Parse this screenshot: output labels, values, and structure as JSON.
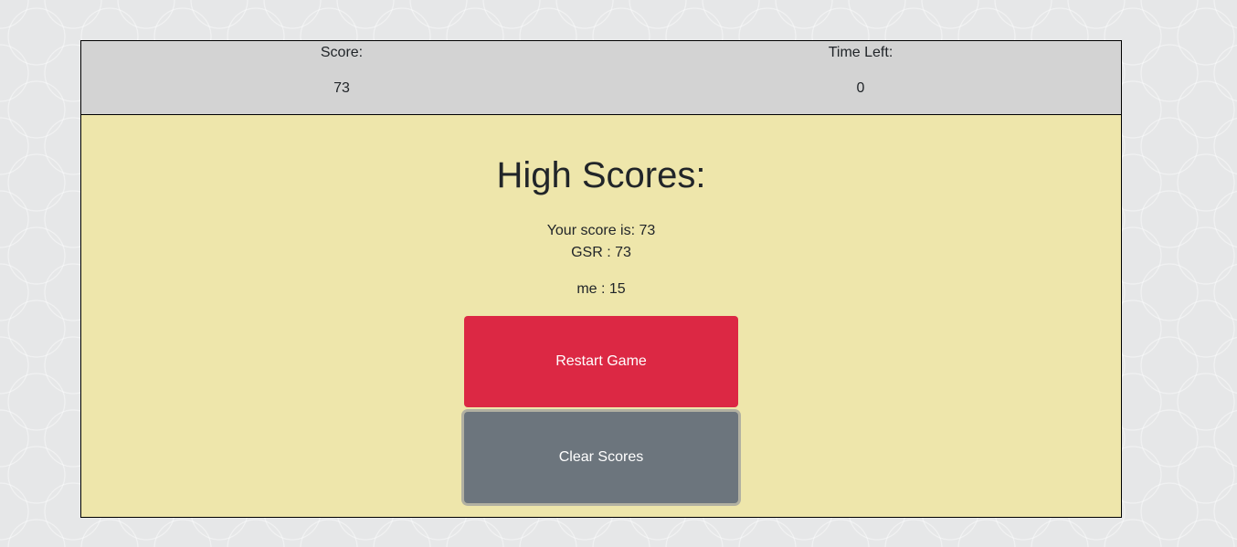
{
  "header": {
    "score_label": "Score:",
    "score_value": "73",
    "time_label": "Time Left:",
    "time_value": "0"
  },
  "main": {
    "title": "High Scores:",
    "your_score": "Your score is: 73",
    "scores": [
      "GSR : 73",
      "me : 15"
    ],
    "restart_label": "Restart Game",
    "clear_label": "Clear Scores"
  },
  "colors": {
    "header_bg": "#d3d3d3",
    "main_bg": "#eee6ab",
    "restart_btn": "#dc2844",
    "clear_btn": "#6c757d"
  }
}
